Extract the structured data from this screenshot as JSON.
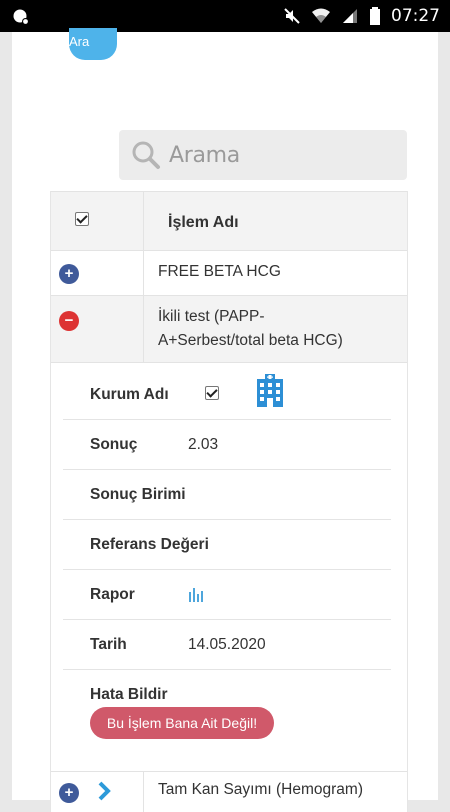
{
  "status_bar": {
    "time": "07:27"
  },
  "header": {
    "ara_label": "Ara"
  },
  "search": {
    "placeholder": "Arama"
  },
  "table": {
    "header_title": "İşlem Adı",
    "rows": [
      {
        "name": "FREE BETA HCG"
      },
      {
        "name_line1": "İkili test (PAPP-",
        "name_line2": "A+Serbest/total beta HCG)"
      }
    ],
    "detail": {
      "kurum_label": "Kurum Adı",
      "sonuc_label": "Sonuç",
      "sonuc_value": "2.03",
      "sonuc_birimi_label": "Sonuç Birimi",
      "referans_label": "Referans Değeri",
      "rapor_label": "Rapor",
      "tarih_label": "Tarih",
      "tarih_value": "14.05.2020",
      "hata_label": "Hata Bildir",
      "hata_button": "Bu İşlem Bana Ait Değil!"
    },
    "last_row": {
      "name": "Tam Kan Sayımı (Hemogram)"
    }
  },
  "colors": {
    "accent": "#4eb3ea",
    "plus": "#3f5a9a",
    "minus": "#dd3333",
    "error_button": "#d0596a",
    "hospital_icon": "#2d8fd5"
  }
}
